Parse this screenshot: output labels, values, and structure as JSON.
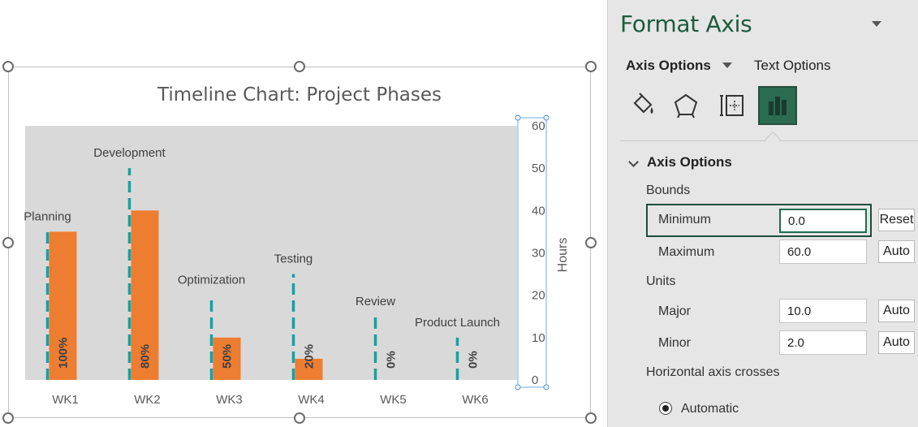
{
  "chart_data": {
    "type": "bar",
    "title": "Timeline Chart: Project Phases",
    "categories": [
      "WK1",
      "WK2",
      "WK3",
      "WK4",
      "WK5",
      "WK6"
    ],
    "phase_labels": [
      "Planning",
      "Development",
      "Optimization",
      "Testing",
      "Review",
      "Product Launch"
    ],
    "series": [
      {
        "values": [
          35,
          40,
          10,
          5,
          0,
          0
        ],
        "data_labels": [
          "100%",
          "80%",
          "50%",
          "20%",
          "0%",
          "0%"
        ]
      },
      {
        "values": [
          35,
          50,
          20,
          25,
          15,
          10
        ]
      }
    ],
    "ylabel": "Hours",
    "ylim": [
      0,
      60
    ],
    "yticks": [
      "0",
      "10",
      "20",
      "30",
      "40",
      "50",
      "60"
    ],
    "colors": {
      "bar": "#ed7d31",
      "line": "#1f9e9e",
      "plot_bg": "#d9d9d9"
    }
  },
  "pane": {
    "title": "Format Axis",
    "tab_axis_options": "Axis Options",
    "tab_text_options": "Text Options",
    "icons": [
      "fill-line-icon",
      "effects-pentagon-icon",
      "size-properties-icon",
      "axis-options-chart-icon"
    ],
    "section_title": "Axis Options",
    "bounds_label": "Bounds",
    "minimum_label": "Minimum",
    "minimum_value": "0.0",
    "minimum_button": "Reset",
    "maximum_label": "Maximum",
    "maximum_value": "60.0",
    "maximum_button": "Auto",
    "units_label": "Units",
    "major_label": "Major",
    "major_value": "10.0",
    "major_button": "Auto",
    "minor_label": "Minor",
    "minor_value": "2.0",
    "minor_button": "Auto",
    "crosses_label": "Horizontal axis crosses",
    "automatic_label": "Automatic"
  }
}
